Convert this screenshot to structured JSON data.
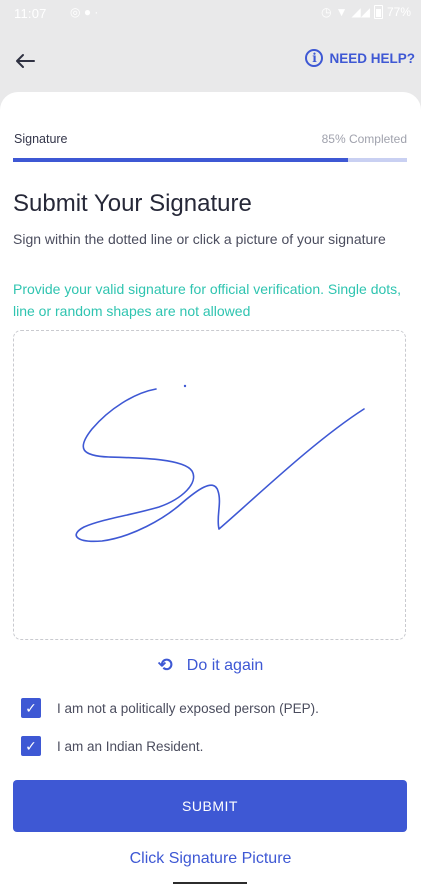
{
  "status_bar": {
    "time": "11:07",
    "battery": "77%"
  },
  "header": {
    "help_label": "NEED HELP?"
  },
  "progress": {
    "label": "Signature",
    "percent_text": "85% Completed",
    "fraction": 0.85
  },
  "page": {
    "title": "Submit Your Signature",
    "subtitle": "Sign within the dotted line or click a picture of your signature",
    "notice": "Provide your valid signature for official verification. Single dots, line or random shapes are not allowed"
  },
  "actions": {
    "redo_label": "Do it again",
    "submit_label": "SUBMIT",
    "picture_label": "Click Signature Picture"
  },
  "checkboxes": [
    {
      "label": "I am not a politically exposed person (PEP).",
      "checked": true
    },
    {
      "label": "I am an Indian Resident.",
      "checked": true
    }
  ],
  "colors": {
    "accent": "#3e58d4",
    "notice": "#2fc4b0",
    "signature_ink": "#3e58d4"
  },
  "icons": {
    "back": "arrow-left-icon",
    "help": "info-icon",
    "redo": "refresh-icon",
    "check": "check-icon"
  }
}
